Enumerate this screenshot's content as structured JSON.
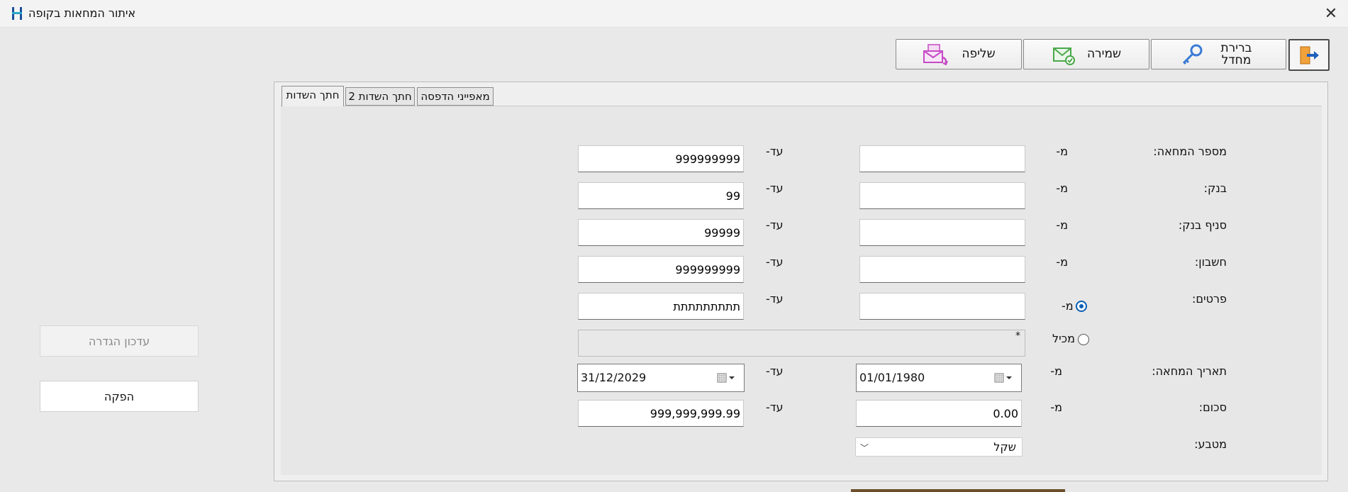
{
  "window": {
    "title": "איתור המחאות בקופה"
  },
  "toolbar": {
    "select_branch_label": "ברירת מחדל",
    "save_label": "שמירה",
    "retrieve_label": "שליפה"
  },
  "tabs": [
    {
      "label": "חתך השדות"
    },
    {
      "label": "חתך השדות 2"
    },
    {
      "label": "מאפייני הדפסה"
    }
  ],
  "form": {
    "from_label": "מ-",
    "to_label": "עד-",
    "check_number": {
      "label": "מספר המחאה:",
      "from_value": "",
      "to_value": "999999999"
    },
    "bank": {
      "label": "בנק:",
      "from_value": "",
      "to_value": "99"
    },
    "bank_branch": {
      "label": "סניף בנק:",
      "from_value": "",
      "to_value": "99999"
    },
    "account": {
      "label": "חשבון:",
      "from_value": "",
      "to_value": "999999999"
    },
    "details": {
      "label": "פרטים:",
      "from_value": "",
      "to_value": "תתתתתתתתת",
      "radio_from_label": "מ-",
      "radio_contains_label": "מכיל",
      "contains_value": "*",
      "selected": "from"
    },
    "check_date": {
      "label": "תאריך המחאה:",
      "from_value": "01/01/1980",
      "to_value": "31/12/2029"
    },
    "amount": {
      "label": "סכום:",
      "from_value": "0.00",
      "to_value": "999,999,999.99"
    },
    "currency": {
      "label": "מטבע:",
      "value": "שקל"
    }
  },
  "side": {
    "update_definition_label": "עדכון הגדרה",
    "produce_label": "הפקה"
  }
}
